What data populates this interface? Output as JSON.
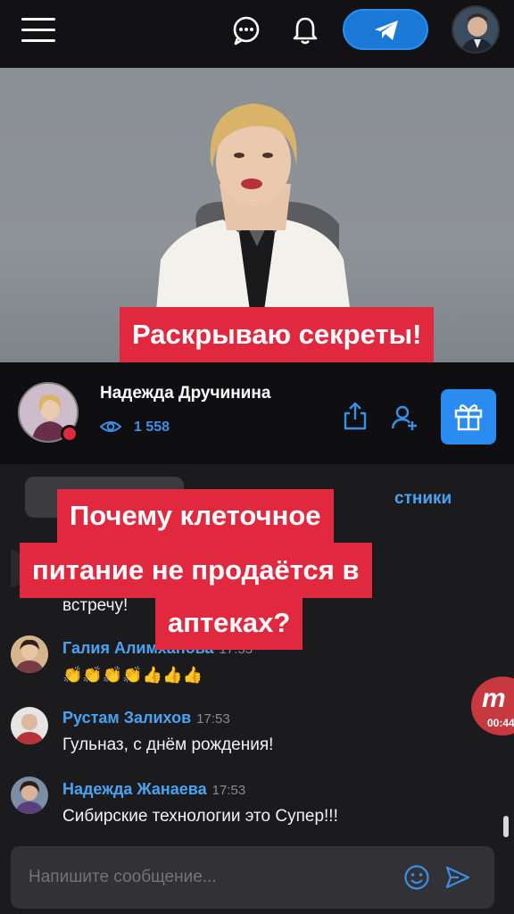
{
  "header": {
    "icons": [
      "menu-icon",
      "chat-bubble-icon",
      "bell-icon",
      "telegram-icon"
    ]
  },
  "video": {
    "caption": "Раскрываю секреты!"
  },
  "streamer": {
    "name": "Надежда Дручинина",
    "views": "1 558"
  },
  "tabs": {
    "right_label": "стники"
  },
  "overlay_caption": {
    "line1": "Почему клеточное",
    "line2": "питание не продаётся в",
    "line3": "аптеках?"
  },
  "chat": {
    "partial_text": "встречу!",
    "messages": [
      {
        "name": "Галия Алимханова",
        "time": "17:53",
        "text": "👏👏👏👏👍👍👍"
      },
      {
        "name": "Рустам Залихов",
        "time": "17:53",
        "text": "Гульназ, с днём рождения!"
      },
      {
        "name": "Надежда Жанаева",
        "time": "17:53",
        "text": "Сибирские технологии это Супер!!!"
      }
    ]
  },
  "floating": {
    "time": "00:44"
  },
  "input": {
    "placeholder": "Напишите сообщение..."
  },
  "colors": {
    "accent": "#2a8bf0",
    "caption_bg": "#e0283f",
    "name_color": "#4aa3f2"
  }
}
